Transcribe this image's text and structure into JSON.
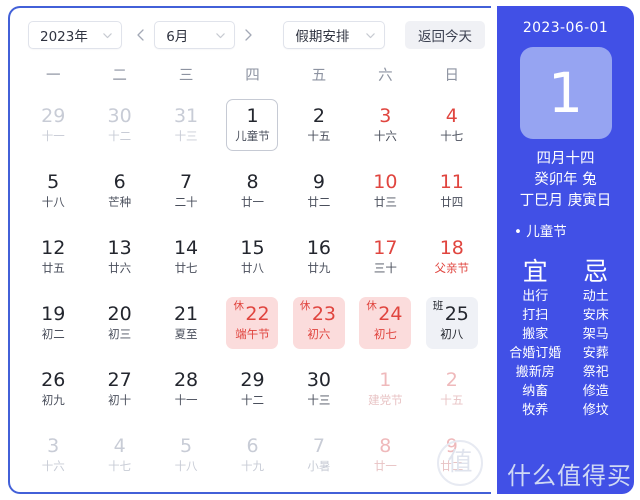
{
  "toolbar": {
    "year": "2023年",
    "month": "6月",
    "holiday_filter": "假期安排",
    "today_button": "返回今天",
    "prev_icon": "chevron-left-icon",
    "next_icon": "chevron-right-icon"
  },
  "calendar": {
    "weekdays": [
      "一",
      "二",
      "三",
      "四",
      "五",
      "六",
      "日"
    ],
    "days": [
      {
        "num": "29",
        "sub": "十一",
        "state": "out"
      },
      {
        "num": "30",
        "sub": "十二",
        "state": "out"
      },
      {
        "num": "31",
        "sub": "十三",
        "state": "out"
      },
      {
        "num": "1",
        "sub": "儿童节",
        "state": "selected"
      },
      {
        "num": "2",
        "sub": "十五",
        "state": "normal"
      },
      {
        "num": "3",
        "sub": "十六",
        "state": "weekend"
      },
      {
        "num": "4",
        "sub": "十七",
        "state": "weekend"
      },
      {
        "num": "5",
        "sub": "十八",
        "state": "normal"
      },
      {
        "num": "6",
        "sub": "芒种",
        "state": "normal"
      },
      {
        "num": "7",
        "sub": "二十",
        "state": "normal"
      },
      {
        "num": "8",
        "sub": "廿一",
        "state": "normal"
      },
      {
        "num": "9",
        "sub": "廿二",
        "state": "normal"
      },
      {
        "num": "10",
        "sub": "廿三",
        "state": "weekend"
      },
      {
        "num": "11",
        "sub": "廿四",
        "state": "weekend"
      },
      {
        "num": "12",
        "sub": "廿五",
        "state": "normal"
      },
      {
        "num": "13",
        "sub": "廿六",
        "state": "normal"
      },
      {
        "num": "14",
        "sub": "廿七",
        "state": "normal"
      },
      {
        "num": "15",
        "sub": "廿八",
        "state": "normal"
      },
      {
        "num": "16",
        "sub": "廿九",
        "state": "normal"
      },
      {
        "num": "17",
        "sub": "三十",
        "state": "weekend"
      },
      {
        "num": "18",
        "sub": "父亲节",
        "state": "weekend-festival"
      },
      {
        "num": "19",
        "sub": "初二",
        "state": "normal"
      },
      {
        "num": "20",
        "sub": "初三",
        "state": "normal"
      },
      {
        "num": "21",
        "sub": "夏至",
        "state": "normal"
      },
      {
        "num": "22",
        "sub": "端午节",
        "state": "rest",
        "badge": "休"
      },
      {
        "num": "23",
        "sub": "初六",
        "state": "rest",
        "badge": "休"
      },
      {
        "num": "24",
        "sub": "初七",
        "state": "rest",
        "badge": "休"
      },
      {
        "num": "25",
        "sub": "初八",
        "state": "work",
        "badge": "班"
      },
      {
        "num": "26",
        "sub": "初九",
        "state": "normal"
      },
      {
        "num": "27",
        "sub": "初十",
        "state": "normal"
      },
      {
        "num": "28",
        "sub": "十一",
        "state": "normal"
      },
      {
        "num": "29",
        "sub": "十二",
        "state": "normal"
      },
      {
        "num": "30",
        "sub": "十三",
        "state": "normal"
      },
      {
        "num": "1",
        "sub": "建党节",
        "state": "out-weekend"
      },
      {
        "num": "2",
        "sub": "十五",
        "state": "out-weekend"
      },
      {
        "num": "3",
        "sub": "十六",
        "state": "out"
      },
      {
        "num": "4",
        "sub": "十七",
        "state": "out"
      },
      {
        "num": "5",
        "sub": "十八",
        "state": "out"
      },
      {
        "num": "6",
        "sub": "十九",
        "state": "out"
      },
      {
        "num": "7",
        "sub": "小暑",
        "state": "out"
      },
      {
        "num": "8",
        "sub": "廿一",
        "state": "out-weekend"
      },
      {
        "num": "9",
        "sub": "廿二",
        "state": "out-weekend"
      }
    ],
    "watermark_mark": "值"
  },
  "sidebar": {
    "date": "2023-06-01",
    "day_number": "1",
    "lunar": [
      "四月十四",
      "癸卯年 兔",
      "丁巳月 庚寅日"
    ],
    "festival": "• 儿童节",
    "yi": {
      "head": "宜",
      "items": [
        "出行",
        "打扫",
        "搬家",
        "合婚订婚",
        "搬新房",
        "纳畜",
        "牧养"
      ]
    },
    "ji": {
      "head": "忌",
      "items": [
        "动土",
        "安床",
        "架马",
        "安葬",
        "祭祀",
        "修造",
        "修坟"
      ]
    },
    "watermark": "什么值得买"
  },
  "colors": {
    "frame_blue": "#4260d8",
    "sidebar_blue": "#4150e6",
    "big_box_blue": "#96a4f2",
    "rest_pink": "#fbdcdc",
    "rest_red": "#e0453f",
    "work_gray": "#eff1f6"
  }
}
